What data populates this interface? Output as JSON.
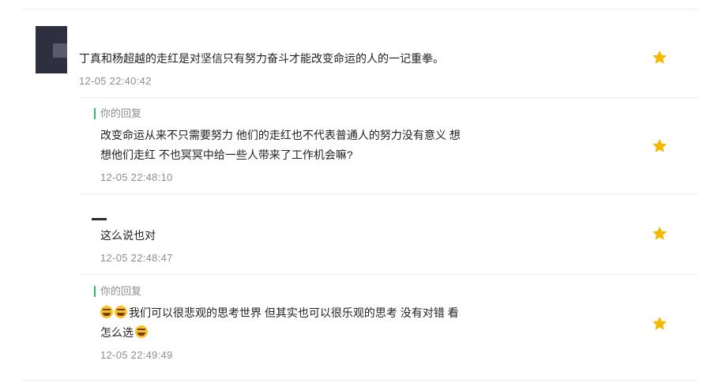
{
  "comment": {
    "text": "丁真和杨超越的走红是对坚信只有努力奋斗才能改变命运的人的一记重拳。",
    "time": "12-05 22:40:42"
  },
  "replies": [
    {
      "label": "你的回复",
      "line1": "改变命运从来不只需要努力 他们的走红也不代表普通人的努力没有意义 想",
      "line2": "想他们走红 不也冥冥中给一些人带来了工作机会嘛?",
      "time": "12-05 22:48:10"
    },
    {
      "text": "这么说也对",
      "time": "12-05 22:48:47"
    },
    {
      "label": "你的回复",
      "line1": "我们可以很悲观的思考世界 但其实也可以很乐观的思考 没有对错 看",
      "line2": "怎么选",
      "time": "12-05 22:49:49"
    }
  ],
  "colors": {
    "star": "#f5b800",
    "reply_bar": "#2dbe60",
    "avatar": "#2e3040"
  },
  "icons": [
    "star-icon",
    "grinning-emoji-icon",
    "smiling-emoji-icon"
  ]
}
